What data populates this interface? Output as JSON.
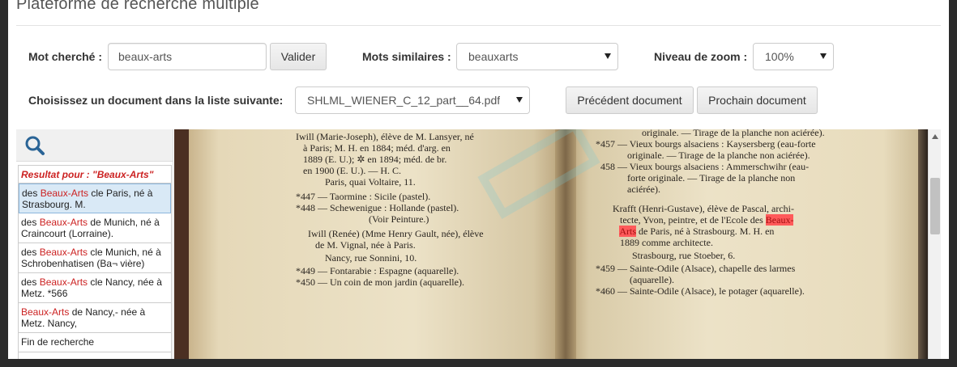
{
  "platform": {
    "title": "Plateforme de recherche multiple"
  },
  "controls": {
    "word_label": "Mot cherché :",
    "word_value": "beaux-arts",
    "validate_label": "Valider",
    "similar_label": "Mots similaires :",
    "similar_value": "beauxarts",
    "zoom_label": "Niveau de zoom :",
    "zoom_value": "100%",
    "doc_label": "Choisissez un document dans la liste suivante:",
    "doc_value": "SHLML_WIENER_C_12_part__64.pdf",
    "prev_label": "Précédent document",
    "next_label": "Prochain document"
  },
  "sidebar": {
    "search_icon": "search-icon",
    "results_header": "Resultat pour : \"Beaux-Arts\"",
    "results": [
      {
        "before": "des ",
        "hl": "Beaux-Arts",
        "after": " cle Paris, né à Strasbourg. M."
      },
      {
        "before": "des ",
        "hl": "Beaux-Arts",
        "after": " de Munich, né à Craincourt (Lorraine)."
      },
      {
        "before": "des ",
        "hl": "Beaux-Arts",
        "after": " cle Munich, né à Schrobenhatisen (Ba¬ vière)"
      },
      {
        "before": "des ",
        "hl": "Beaux-Arts",
        "after": " cle Nancy, née à Metz. *566"
      },
      {
        "before": "",
        "hl": "Beaux-Arts",
        "after": " de Nancy,- née à Metz. Nancy,"
      },
      {
        "before": "",
        "hl": "",
        "after": "Fin de recherche"
      }
    ]
  },
  "document": {
    "left_lines": [
      "Iwill (Marie-Joseph), élève de M. Lansyer, né",
      "   à Paris; M. H. en 1884; méd. d'arg. en",
      "   1889 (E. U.); ✲ en 1894; méd. de br.",
      "   en 1900 (E. U.). — H. C.",
      "            Paris, quai Voltaire, 11.",
      "*447 — Taormine : Sicile (pastel).",
      "*448 — Schewenigue : Hollande (pastel).",
      "                              (Voir Peinture.)",
      "     Iwill (Renée) (Mme Henry Gault, née), élève",
      "        de M. Vignal, née à Paris.",
      "            Nancy, rue Sonnini, 10.",
      "*449 — Fontarabie : Espagne (aquarelle).",
      "*450 — Un coin de mon jardin (aquarelle)."
    ],
    "right_lines_a": [
      "                   originale. — Tirage de la planche non aciérée).",
      "*457 — Vieux bourgs alsaciens : Kaysersberg (eau-forte",
      "             originale. — Tirage de la planche non aciérée).",
      "  458 — Vieux bourgs alsaciens : Ammerschwihr (eau-",
      "             forte originale. — Tirage de la planche non",
      "             aciérée).",
      "       Krafft (Henri-Gustave), élève de Pascal, archi-",
      "          tecte, Yvon, peintre, et de l'Ecole des "
    ],
    "mark1": "Beaux-",
    "mark2": "Arts",
    "right_line_after_mark": " de Paris, né à Strasbourg. M. H. en",
    "right_lines_b": [
      "          1889 comme architecte.",
      "               Strasbourg, rue Stoeber, 6.",
      "*459 — Sainte-Odile (Alsace), chapelle des larmes",
      "              (aquarelle).",
      "*460 — Sainte-Odile (Alsace), le potager (aquarelle)."
    ]
  }
}
